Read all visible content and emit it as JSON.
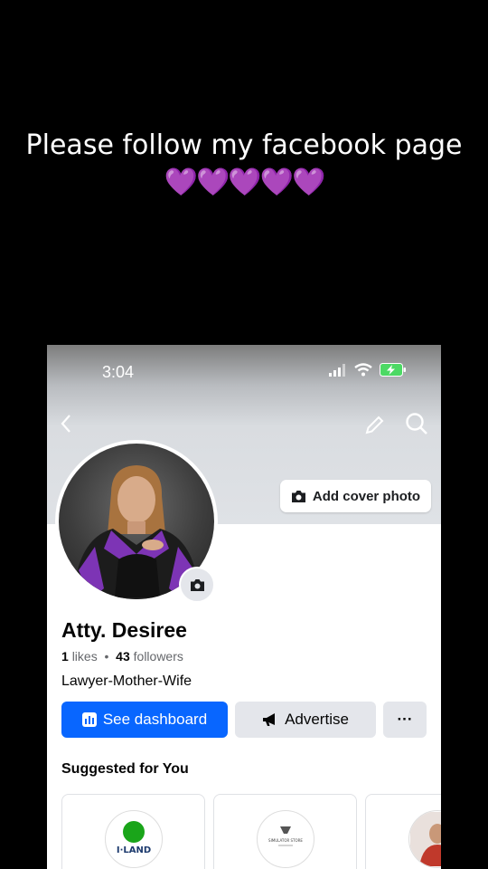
{
  "overlay": {
    "caption": "Please follow my facebook page",
    "hearts": "💜💜💜💜💜"
  },
  "status_bar": {
    "time": "3:04"
  },
  "cover": {
    "add_cover_label": "Add cover photo"
  },
  "profile": {
    "name": "Atty. Desiree",
    "likes_count": "1",
    "likes_label": "likes",
    "followers_count": "43",
    "followers_label": "followers",
    "bio": "Lawyer-Mother-Wife"
  },
  "actions": {
    "dashboard_label": "See dashboard",
    "advertise_label": "Advertise",
    "more_label": "···"
  },
  "suggestions": {
    "title": "Suggested for You",
    "cards": [
      {
        "logo_text": "I·LAND"
      },
      {
        "logo_text": "SIMULATOR STORE"
      },
      {
        "logo_text": ""
      }
    ]
  },
  "colors": {
    "primary": "#0866ff",
    "secondary_button": "#e4e6eb",
    "heart": "#a64ddb"
  }
}
